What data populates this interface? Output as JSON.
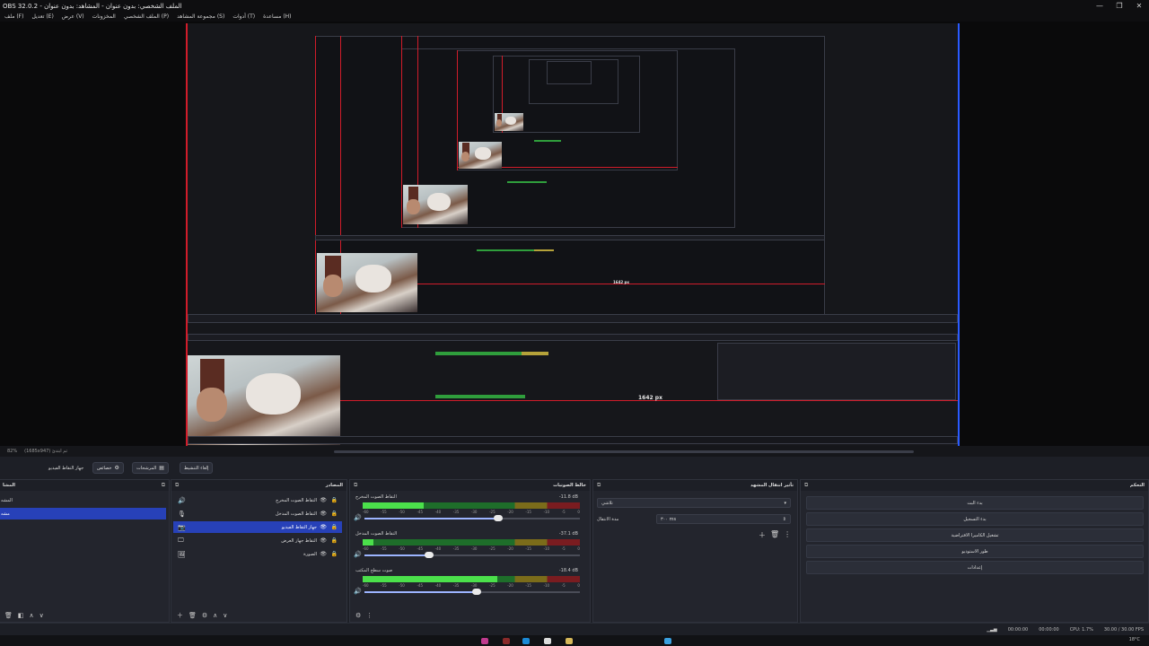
{
  "window": {
    "title": "OBS 32.0.2 - الملف الشخصي: بدون عنوان - المشاهد: بدون عنوان",
    "controls": [
      "—",
      "❐",
      "✕"
    ]
  },
  "menu": [
    "ملف (F)",
    "تعديل (E)",
    "عرض (V)",
    "المخزونات",
    "الملف الشخصي (P)",
    "مجموعة المشاهد (S)",
    "أدوات (T)",
    "مساعدة (H)"
  ],
  "preview": {
    "label_big": "1642 px",
    "label_small": "1642 px",
    "status_left": "82%",
    "status_mid": "(1685x947) ثم ابتدئ"
  },
  "toolbar": {
    "video_device": "جهاز التقاط الفيديو",
    "properties": "خصائص",
    "filters": "المرشحات",
    "deactivate": "إلغاء التنشيط"
  },
  "scenes": {
    "title": "المشا",
    "items": [
      "المشه",
      "مشه"
    ]
  },
  "sources": {
    "title": "المصادر",
    "items": [
      {
        "label": "التقاط الصوت المخرج",
        "icon": "speaker-icon"
      },
      {
        "label": "التقاط الصوت المدخل",
        "icon": "mic-icon"
      },
      {
        "label": "جهاز التقاط الفيديو",
        "icon": "camera-icon"
      },
      {
        "label": "التقاط جهاز العرض",
        "icon": "monitor-icon"
      },
      {
        "label": "الصورة",
        "icon": "image-icon"
      }
    ]
  },
  "mixer": {
    "title": "خالط الصوتيات",
    "channels": [
      {
        "name": "التقاط الصوت المخرج",
        "db": "-11.8 dB",
        "level": 0.28,
        "volume": 0.62
      },
      {
        "name": "التقاط الصوت المدخل",
        "db": "-37.1 dB",
        "level": 0.05,
        "volume": 0.3
      },
      {
        "name": "صوت سطح المكتب",
        "db": "-18.4 dB",
        "level": 0.62,
        "volume": 0.52
      }
    ],
    "ticks": [
      "-60",
      "-55",
      "-50",
      "-45",
      "-40",
      "-35",
      "-30",
      "-25",
      "-20",
      "-15",
      "-10",
      "-5",
      "0"
    ]
  },
  "transitions": {
    "title": "تأثير انتقال المشهد",
    "type": "تلاشي",
    "duration_label": "مدة الانتقال",
    "duration_value": "٣٠٠ ms"
  },
  "controls": {
    "title": "التحكم",
    "buttons": [
      "بدء البث",
      "بدء التسجيل",
      "تشغيل الكاميرا الافتراضية",
      "طور الاستوديو",
      "إعدادات"
    ]
  },
  "status": {
    "time1": "00:00:00",
    "time2": "00:00:00",
    "cpu": "CPU: 1.7%",
    "fps": "30.00 / 30.00 FPS"
  },
  "taskbar": {
    "temp": "18°C"
  }
}
